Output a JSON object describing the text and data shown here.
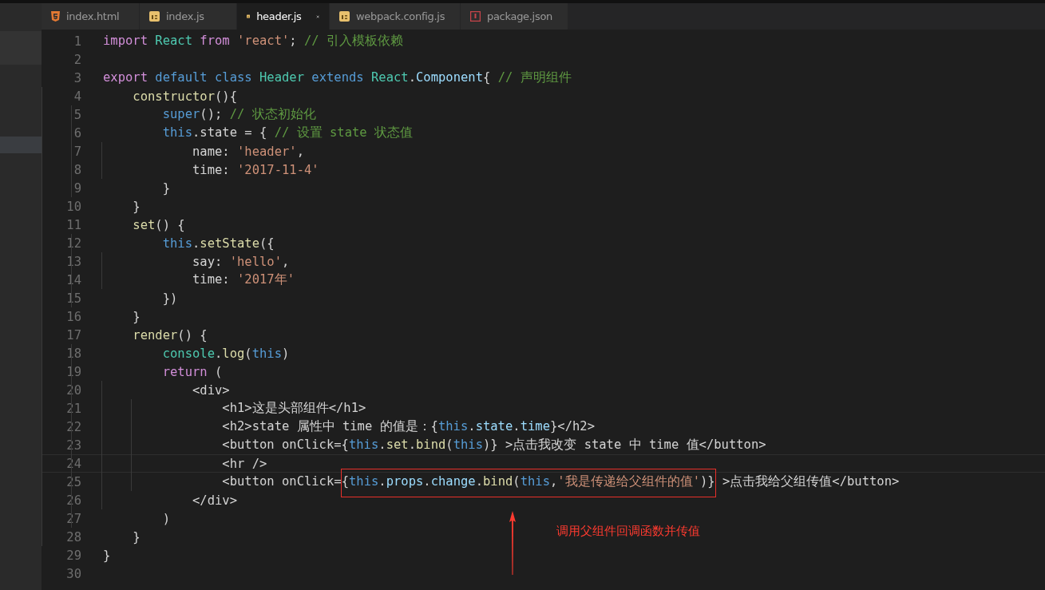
{
  "tabs": [
    {
      "label": "index.html",
      "kind": "html",
      "selected": false
    },
    {
      "label": "index.js",
      "kind": "js",
      "selected": false
    },
    {
      "label": "header.js",
      "kind": "js",
      "selected": true
    },
    {
      "label": "webpack.config.js",
      "kind": "js",
      "selected": false
    },
    {
      "label": "package.json",
      "kind": "json",
      "selected": false
    }
  ],
  "editor": {
    "lines": [
      {
        "number": "1",
        "current": false,
        "tokens": [
          {
            "kind": "kw",
            "text": "import "
          },
          {
            "kind": "type",
            "text": "React "
          },
          {
            "kind": "kw",
            "text": "from "
          },
          {
            "kind": "str",
            "text": "'react'"
          },
          {
            "kind": "plain",
            "text": "; "
          },
          {
            "kind": "cmt",
            "text": "// 引入模板依赖"
          }
        ]
      },
      {
        "number": "2",
        "current": false
      },
      {
        "number": "3",
        "current": false,
        "tokens": [
          {
            "kind": "kw",
            "text": "export "
          },
          {
            "kind": "storage",
            "text": "default class "
          },
          {
            "kind": "type",
            "text": "Header "
          },
          {
            "kind": "storage",
            "text": "extends "
          },
          {
            "kind": "type",
            "text": "React"
          },
          {
            "kind": "plain",
            "text": "."
          },
          {
            "kind": "prop",
            "text": "Component"
          },
          {
            "kind": "plain",
            "text": "{ "
          },
          {
            "kind": "cmt",
            "text": "// 声明组件"
          }
        ]
      },
      {
        "number": "4",
        "current": false,
        "tokens": [
          {
            "kind": "fn",
            "text": "    constructor"
          },
          {
            "kind": "plain",
            "text": "(){"
          }
        ]
      },
      {
        "number": "5",
        "current": false,
        "tokens": [
          {
            "kind": "storage",
            "text": "        super"
          },
          {
            "kind": "plain",
            "text": "(); "
          },
          {
            "kind": "cmt",
            "text": "// 状态初始化"
          }
        ]
      },
      {
        "number": "6",
        "current": false,
        "tokens": [
          {
            "kind": "storage",
            "text": "        this"
          },
          {
            "kind": "plain",
            "text": ".state = { "
          },
          {
            "kind": "cmt",
            "text": "// 设置 state 状态值"
          }
        ]
      },
      {
        "number": "7",
        "current": false,
        "tokens": [
          {
            "kind": "plain",
            "text": "            name: "
          },
          {
            "kind": "str",
            "text": "'header'"
          },
          {
            "kind": "plain",
            "text": ","
          }
        ]
      },
      {
        "number": "8",
        "current": false,
        "tokens": [
          {
            "kind": "plain",
            "text": "            time: "
          },
          {
            "kind": "str",
            "text": "'2017-11-4'"
          }
        ]
      },
      {
        "number": "9",
        "current": false,
        "tokens": [
          {
            "kind": "plain",
            "text": "        }"
          }
        ]
      },
      {
        "number": "10",
        "current": false,
        "tokens": [
          {
            "kind": "plain",
            "text": "    }"
          }
        ]
      },
      {
        "number": "11",
        "current": false,
        "tokens": [
          {
            "kind": "fn",
            "text": "    set"
          },
          {
            "kind": "plain",
            "text": "() {"
          }
        ]
      },
      {
        "number": "12",
        "current": false,
        "tokens": [
          {
            "kind": "storage",
            "text": "        this"
          },
          {
            "kind": "plain",
            "text": "."
          },
          {
            "kind": "fn",
            "text": "setState"
          },
          {
            "kind": "plain",
            "text": "({"
          }
        ]
      },
      {
        "number": "13",
        "current": false,
        "tokens": [
          {
            "kind": "plain",
            "text": "            say: "
          },
          {
            "kind": "str",
            "text": "'hello'"
          },
          {
            "kind": "plain",
            "text": ","
          }
        ]
      },
      {
        "number": "14",
        "current": false,
        "tokens": [
          {
            "kind": "plain",
            "text": "            time: "
          },
          {
            "kind": "str",
            "text": "'2017年'"
          }
        ]
      },
      {
        "number": "15",
        "current": false,
        "tokens": [
          {
            "kind": "plain",
            "text": "        })"
          }
        ]
      },
      {
        "number": "16",
        "current": false,
        "tokens": [
          {
            "kind": "plain",
            "text": "    }"
          }
        ]
      },
      {
        "number": "17",
        "current": false,
        "tokens": [
          {
            "kind": "fn",
            "text": "    render"
          },
          {
            "kind": "plain",
            "text": "() {"
          }
        ]
      },
      {
        "number": "18",
        "current": false,
        "tokens": [
          {
            "kind": "type",
            "text": "        console"
          },
          {
            "kind": "plain",
            "text": "."
          },
          {
            "kind": "fn",
            "text": "log"
          },
          {
            "kind": "plain",
            "text": "("
          },
          {
            "kind": "storage",
            "text": "this"
          },
          {
            "kind": "plain",
            "text": ")"
          }
        ]
      },
      {
        "number": "19",
        "current": false,
        "tokens": [
          {
            "kind": "kw",
            "text": "        return "
          },
          {
            "kind": "plain",
            "text": "("
          }
        ]
      },
      {
        "number": "20",
        "current": false,
        "tokens": [
          {
            "kind": "plain",
            "text": "            <div>"
          }
        ]
      },
      {
        "number": "21",
        "current": false,
        "tokens": [
          {
            "kind": "plain",
            "text": "                <h1>这是头部组件</h1>"
          }
        ]
      },
      {
        "number": "22",
        "current": false,
        "tokens": [
          {
            "kind": "plain",
            "text": "                <h2>state 属性中 time 的值是：{"
          },
          {
            "kind": "storage",
            "text": "this"
          },
          {
            "kind": "plain",
            "text": "."
          },
          {
            "kind": "prop",
            "text": "state"
          },
          {
            "kind": "plain",
            "text": "."
          },
          {
            "kind": "prop",
            "text": "time"
          },
          {
            "kind": "plain",
            "text": "}</h2>"
          }
        ]
      },
      {
        "number": "23",
        "current": false,
        "tokens": [
          {
            "kind": "plain",
            "text": "                <button onClick={"
          },
          {
            "kind": "storage",
            "text": "this"
          },
          {
            "kind": "plain",
            "text": "."
          },
          {
            "kind": "fn",
            "text": "set"
          },
          {
            "kind": "plain",
            "text": "."
          },
          {
            "kind": "fn",
            "text": "bind"
          },
          {
            "kind": "plain",
            "text": "("
          },
          {
            "kind": "storage",
            "text": "this"
          },
          {
            "kind": "plain",
            "text": ")} >点击我改变 state 中 time 值</button>"
          }
        ]
      },
      {
        "number": "24",
        "current": true,
        "tokens": [
          {
            "kind": "plain",
            "text": "                <hr />"
          }
        ]
      },
      {
        "number": "25",
        "current": false,
        "tokens": [
          {
            "kind": "plain",
            "text": "                <button onClick="
          }
        ],
        "boxed_tokens": [
          {
            "kind": "plain",
            "text": "{"
          },
          {
            "kind": "storage",
            "text": "this"
          },
          {
            "kind": "plain",
            "text": "."
          },
          {
            "kind": "prop",
            "text": "props"
          },
          {
            "kind": "plain",
            "text": "."
          },
          {
            "kind": "prop",
            "text": "change"
          },
          {
            "kind": "plain",
            "text": "."
          },
          {
            "kind": "fn",
            "text": "bind"
          },
          {
            "kind": "plain",
            "text": "("
          },
          {
            "kind": "storage",
            "text": "this"
          },
          {
            "kind": "plain",
            "text": ","
          },
          {
            "kind": "str",
            "text": "'我是传递给父组件的值'"
          },
          {
            "kind": "plain",
            "text": ")}"
          }
        ],
        "tail_tokens": [
          {
            "kind": "plain",
            "text": " >点击我给父组传值</button>"
          }
        ]
      },
      {
        "number": "26",
        "current": false,
        "tokens": [
          {
            "kind": "plain",
            "text": "            </div>"
          }
        ]
      },
      {
        "number": "27",
        "current": false,
        "tokens": [
          {
            "kind": "plain",
            "text": "        )"
          }
        ]
      },
      {
        "number": "28",
        "current": false,
        "tokens": [
          {
            "kind": "plain",
            "text": "    }"
          }
        ]
      },
      {
        "number": "29",
        "current": false,
        "tokens": [
          {
            "kind": "plain",
            "text": "}"
          }
        ]
      },
      {
        "number": "30",
        "current": false
      }
    ]
  },
  "annotation": {
    "text": "调用父组件回调函数并传值"
  }
}
